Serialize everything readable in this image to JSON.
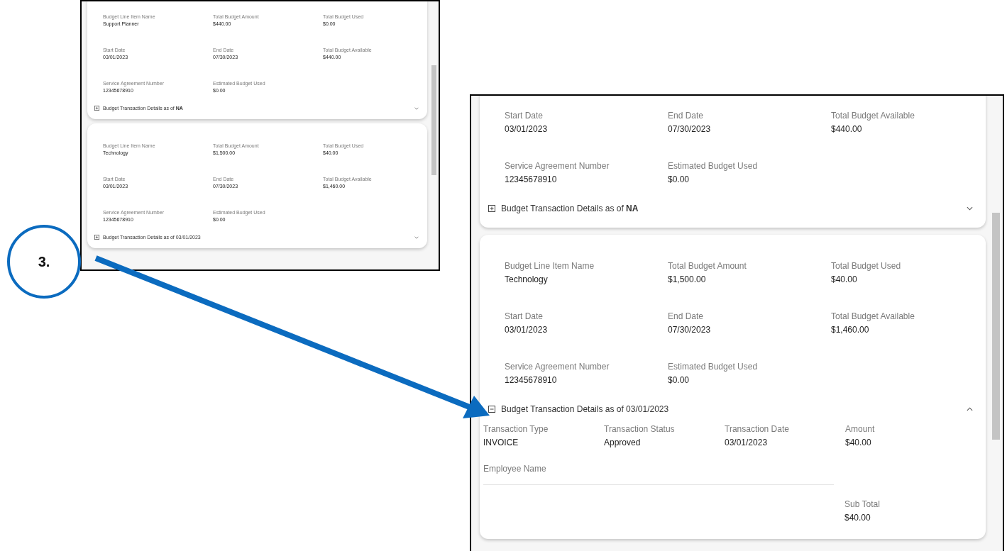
{
  "left_screenshot": {
    "cards": [
      {
        "fields": [
          {
            "label": "Budget Line Item Name",
            "value": "Support Planner"
          },
          {
            "label": "Total Budget Amount",
            "value": "$440.00"
          },
          {
            "label": "Total Budget Used",
            "value": "$0.00"
          },
          {
            "label": "Start Date",
            "value": "03/01/2023"
          },
          {
            "label": "End Date",
            "value": "07/30/2023"
          },
          {
            "label": "Total Budget Available",
            "value": "$440.00"
          },
          {
            "label": "Service Agreement Number",
            "value": "12345678910"
          },
          {
            "label": "Estimated Budget Used",
            "value": "$0.00"
          }
        ],
        "details": {
          "title": "Budget Transaction Details as of **NA**",
          "expanded": false
        }
      },
      {
        "fields": [
          {
            "label": "Budget Line Item Name",
            "value": "Technology"
          },
          {
            "label": "Total Budget Amount",
            "value": "$1,500.00"
          },
          {
            "label": "Total Budget Used",
            "value": "$40.00"
          },
          {
            "label": "Start Date",
            "value": "03/01/2023"
          },
          {
            "label": "End Date",
            "value": "07/30/2023"
          },
          {
            "label": "Total Budget Available",
            "value": "$1,460.00"
          },
          {
            "label": "Service Agreement Number",
            "value": "12345678910"
          },
          {
            "label": "Estimated Budget Used",
            "value": "$0.00"
          }
        ],
        "details": {
          "title": "Budget Transaction Details as of 03/01/2023",
          "expanded": false
        }
      }
    ]
  },
  "right_screenshot": {
    "cards": [
      {
        "fields": [
          {
            "label": "Start Date",
            "value": "03/01/2023"
          },
          {
            "label": "End Date",
            "value": "07/30/2023"
          },
          {
            "label": "Total Budget Available",
            "value": "$440.00"
          },
          {
            "label": "Service Agreement Number",
            "value": "12345678910"
          },
          {
            "label": "Estimated Budget Used",
            "value": "$0.00"
          }
        ],
        "details": {
          "title": "Budget Transaction Details as of **NA**",
          "expanded": false
        }
      },
      {
        "fields": [
          {
            "label": "Budget Line Item Name",
            "value": "Technology"
          },
          {
            "label": "Total Budget Amount",
            "value": "$1,500.00"
          },
          {
            "label": "Total Budget Used",
            "value": "$40.00"
          },
          {
            "label": "Start Date",
            "value": "03/01/2023"
          },
          {
            "label": "End Date",
            "value": "07/30/2023"
          },
          {
            "label": "Total Budget Available",
            "value": "$1,460.00"
          },
          {
            "label": "Service Agreement Number",
            "value": "12345678910"
          },
          {
            "label": "Estimated Budget Used",
            "value": "$0.00"
          }
        ],
        "details": {
          "title": "Budget Transaction Details as of 03/01/2023",
          "expanded": true,
          "transaction": [
            {
              "label": "Transaction Type",
              "value": "INVOICE"
            },
            {
              "label": "Transaction Status",
              "value": "Approved"
            },
            {
              "label": "Transaction Date",
              "value": "03/01/2023"
            },
            {
              "label": "Amount",
              "value": "$40.00"
            }
          ],
          "employee_label": "Employee Name",
          "subtotal": {
            "label": "Sub Total",
            "value": "$40.00"
          }
        }
      }
    ]
  },
  "callout": {
    "label": "3."
  }
}
